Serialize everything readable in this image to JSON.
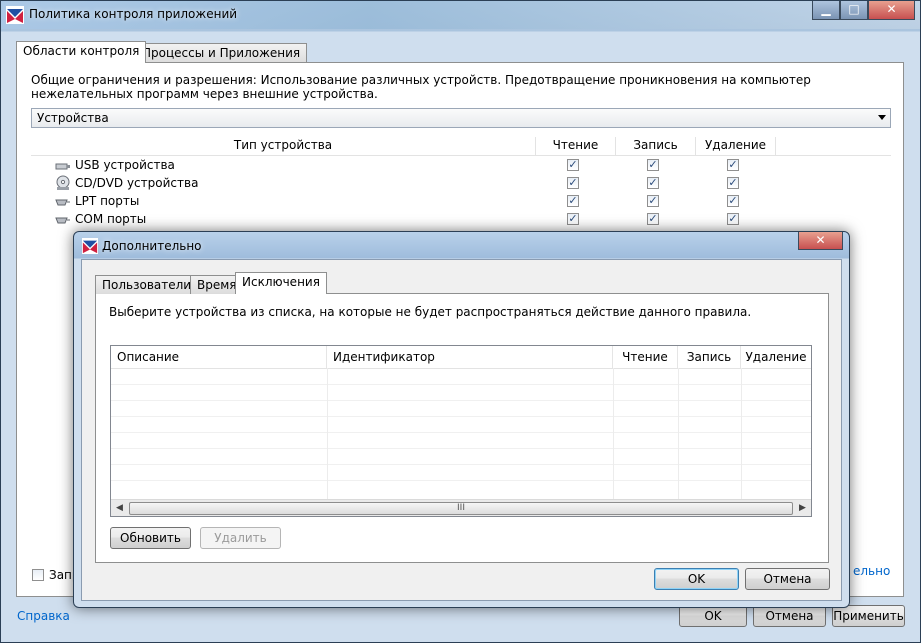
{
  "main_window": {
    "title": "Политика контроля приложений",
    "caption_buttons": {
      "minimize": "▁",
      "maximize": "□",
      "close": "✕"
    },
    "tabs": [
      {
        "label": "Области контроля",
        "active": true
      },
      {
        "label": "Процессы и Приложения",
        "active": false
      }
    ],
    "description": "Общие ограничения и разрешения: Использование различных устройств. Предотвращение проникновения на компьютер нежелательных программ через внешние устройства.",
    "category_select": {
      "value": "Устройства"
    },
    "device_table": {
      "columns": [
        "Тип устройства",
        "Чтение",
        "Запись",
        "Удаление"
      ],
      "rows": [
        {
          "label": "USB устройства",
          "icon": "usb-icon",
          "read": true,
          "write": true,
          "delete": true
        },
        {
          "label": "CD/DVD устройства",
          "icon": "cd-dvd-icon",
          "read": true,
          "write": true,
          "delete": true
        },
        {
          "label": "LPT порты",
          "icon": "port-icon",
          "read": true,
          "write": true,
          "delete": true
        },
        {
          "label": "COM порты",
          "icon": "port-icon",
          "read": true,
          "write": true,
          "delete": true
        }
      ]
    },
    "bottom_checkbox_label": "Запр",
    "right_link_fragment": "ельно",
    "footer": {
      "help": "Справка",
      "ok": "OK",
      "cancel": "Отмена",
      "apply": "Применить"
    }
  },
  "dialog": {
    "title": "Дополнительно",
    "close": "✕",
    "tabs": [
      {
        "label": "Пользователи",
        "active": false
      },
      {
        "label": "Время",
        "active": false
      },
      {
        "label": "Исключения",
        "active": true
      }
    ],
    "instruction": "Выберите устройства из списка, на которые не будет распространяться действие данного правила.",
    "grid_columns": [
      "Описание",
      "Идентификатор",
      "Чтение",
      "Запись",
      "Удаление"
    ],
    "scroll_grip": "III",
    "refresh_button": "Обновить",
    "delete_button": "Удалить",
    "ok": "OK",
    "cancel": "Отмена"
  },
  "colors": {
    "accent": "#0066cc",
    "title_bar": "#b9d1ea",
    "close_red": "#c75050"
  }
}
